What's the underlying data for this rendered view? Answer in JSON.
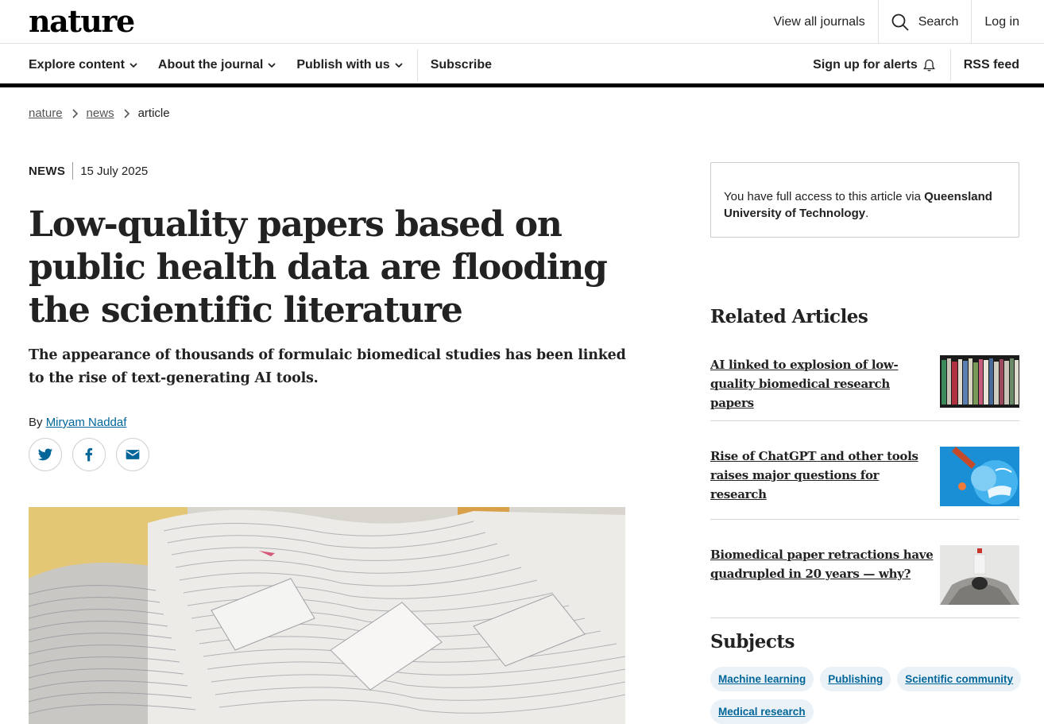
{
  "header": {
    "logo": "nature",
    "view_all_journals": "View all journals",
    "search": "Search",
    "login": "Log in"
  },
  "nav": {
    "explore": "Explore content",
    "about": "About the journal",
    "publish": "Publish with us",
    "subscribe": "Subscribe",
    "alerts": "Sign up for alerts",
    "rss": "RSS feed"
  },
  "breadcrumb": [
    "nature",
    "news",
    "article"
  ],
  "article": {
    "type": "NEWS",
    "date": "15 July 2025",
    "title": "Low-quality papers based on public health data are flooding the scientific literature",
    "standfirst": "The appearance of thousands of formulaic biomedical studies has been linked to the rise of text-generating AI tools.",
    "by": "By",
    "author": "Miryam Naddaf"
  },
  "share": [
    "twitter-icon",
    "facebook-icon",
    "email-icon"
  ],
  "sidebar": {
    "access_prefix": "You have full access to this article via ",
    "access_institution": "Queensland University of Technology",
    "access_suffix": ".",
    "related_heading": "Related Articles",
    "related": [
      "AI linked to explosion of low-quality biomedical research papers",
      "Rise of ChatGPT and other tools raises major questions for research",
      "Biomedical paper retractions have quadrupled in 20 years — why?"
    ],
    "subjects_heading": "Subjects",
    "subjects": [
      "Machine learning",
      "Publishing",
      "Scientific community",
      "Medical research"
    ]
  },
  "colors": {
    "link": "#006699",
    "tag_bg": "#eaf1f7",
    "nav_rule": "#000000"
  }
}
